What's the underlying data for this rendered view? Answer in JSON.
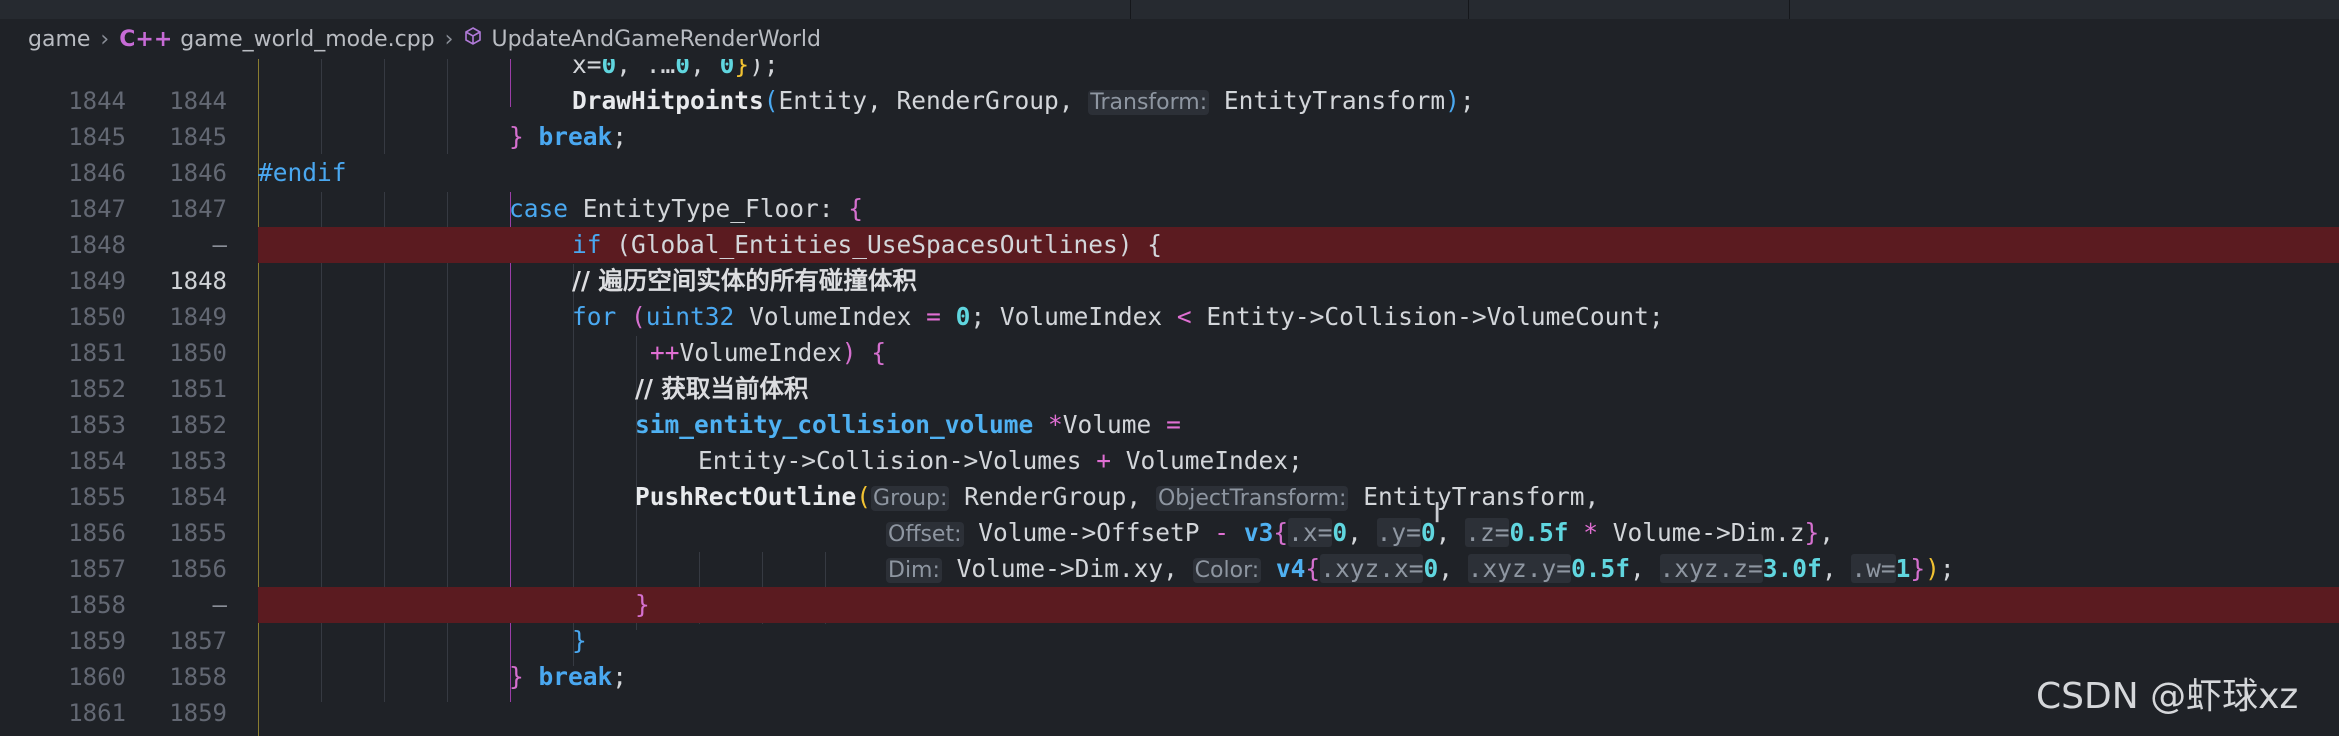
{
  "breadcrumb": {
    "root": "game",
    "file_icon": "C++",
    "file": "game_world_mode.cpp",
    "symbol": "UpdateAndGameRenderWorld"
  },
  "lines": [
    {
      "old": "",
      "new": "",
      "text": "x=0, …0, 0});"
    },
    {
      "old": "1844",
      "new": "1844",
      "text": "DrawHitpoints(Entity, RenderGroup, Transform: EntityTransform);"
    },
    {
      "old": "1845",
      "new": "1845",
      "text": "} break;"
    },
    {
      "old": "1846",
      "new": "1846",
      "text": "#endif"
    },
    {
      "old": "1847",
      "new": "1847",
      "text": "case EntityType_Floor: {"
    },
    {
      "old": "1848",
      "new": "—",
      "text": "if (Global_Entities_UseSpacesOutlines) {"
    },
    {
      "old": "1849",
      "new": "1848",
      "text": "// 遍历空间实体的所有碰撞体积"
    },
    {
      "old": "1850",
      "new": "1849",
      "text": "for (uint32 VolumeIndex = 0; VolumeIndex < Entity->Collision->VolumeCount;"
    },
    {
      "old": "1851",
      "new": "1850",
      "text": "++VolumeIndex) {"
    },
    {
      "old": "1852",
      "new": "1851",
      "text": "// 获取当前体积"
    },
    {
      "old": "1853",
      "new": "1852",
      "text": "sim_entity_collision_volume *Volume ="
    },
    {
      "old": "1854",
      "new": "1853",
      "text": "Entity->Collision->Volumes + VolumeIndex;"
    },
    {
      "old": "1855",
      "new": "1854",
      "text": "PushRectOutline(Group: RenderGroup, ObjectTransform: EntityTransform,"
    },
    {
      "old": "1856",
      "new": "1855",
      "text": "Offset: Volume->OffsetP - v3{.x=0, .y=0, .z=0.5f * Volume->Dim.z},"
    },
    {
      "old": "1857",
      "new": "1856",
      "text": "Dim: Volume->Dim.xy, Color: v4{.xyz.x=0, .xyz.y=0.5f, .xyz.z=3.0f, .w=1});"
    },
    {
      "old": "1858",
      "new": "—",
      "text": "}"
    },
    {
      "old": "1859",
      "new": "1857",
      "text": "}"
    },
    {
      "old": "1860",
      "new": "1858",
      "text": "} break;"
    },
    {
      "old": "1861",
      "new": "1859",
      "text": ""
    }
  ],
  "watermark": "CSDN @虾球xz",
  "colors": {
    "background": "#1f2227",
    "deleted_line": "#5b1b20",
    "keyword": "#4aa8f0",
    "number": "#60d6df",
    "operator": "#e06fd3"
  }
}
